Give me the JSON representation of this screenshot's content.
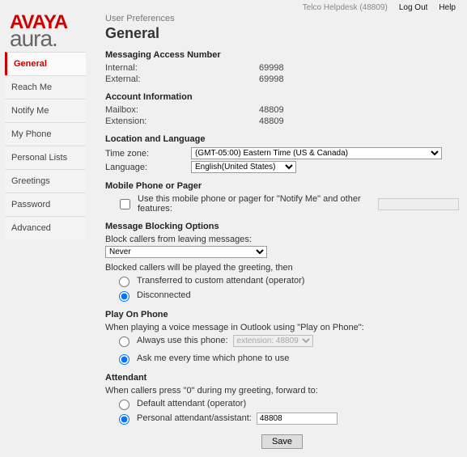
{
  "topbar": {
    "user": "Telco Helpdesk (48809)",
    "logout": "Log Out",
    "help": "Help"
  },
  "brand": {
    "line1": "AVAYA",
    "line2": "aura."
  },
  "sidebar": {
    "items": [
      {
        "label": "General"
      },
      {
        "label": "Reach Me"
      },
      {
        "label": "Notify Me"
      },
      {
        "label": "My Phone"
      },
      {
        "label": "Personal Lists"
      },
      {
        "label": "Greetings"
      },
      {
        "label": "Password"
      },
      {
        "label": "Advanced"
      }
    ],
    "activeIndex": 0
  },
  "breadcrumb": "User Preferences",
  "pageTitle": "General",
  "messagingAccess": {
    "title": "Messaging Access Number",
    "internalLabel": "Internal:",
    "internalValue": "69998",
    "externalLabel": "External:",
    "externalValue": "69998"
  },
  "accountInfo": {
    "title": "Account Information",
    "mailboxLabel": "Mailbox:",
    "mailboxValue": "48809",
    "extensionLabel": "Extension:",
    "extensionValue": "48809"
  },
  "location": {
    "title": "Location and Language",
    "tzLabel": "Time zone:",
    "tzValue": "(GMT-05:00) Eastern Time (US & Canada)",
    "langLabel": "Language:",
    "langValue": "English(United States)"
  },
  "mobile": {
    "title": "Mobile Phone or Pager",
    "checkboxLabel": "Use this mobile phone or pager for \"Notify Me\" and other features:",
    "value": ""
  },
  "blocking": {
    "title": "Message Blocking Options",
    "blockLabel": "Block callers from leaving messages:",
    "blockValue": "Never",
    "thenLabel": "Blocked callers will be played the greeting, then",
    "opt1": "Transferred to custom attendant (operator)",
    "opt2": "Disconnected"
  },
  "playOnPhone": {
    "title": "Play On Phone",
    "intro": "When playing a voice message in Outlook using \"Play on Phone\":",
    "opt1": "Always use this phone:",
    "extValue": "extension: 48809",
    "opt2": "Ask me every time which phone to use"
  },
  "attendant": {
    "title": "Attendant",
    "intro": "When callers press \"0\" during my greeting, forward to:",
    "opt1": "Default attendant (operator)",
    "opt2": "Personal attendant/assistant:",
    "value": "48808"
  },
  "footer": {
    "save": "Save"
  }
}
